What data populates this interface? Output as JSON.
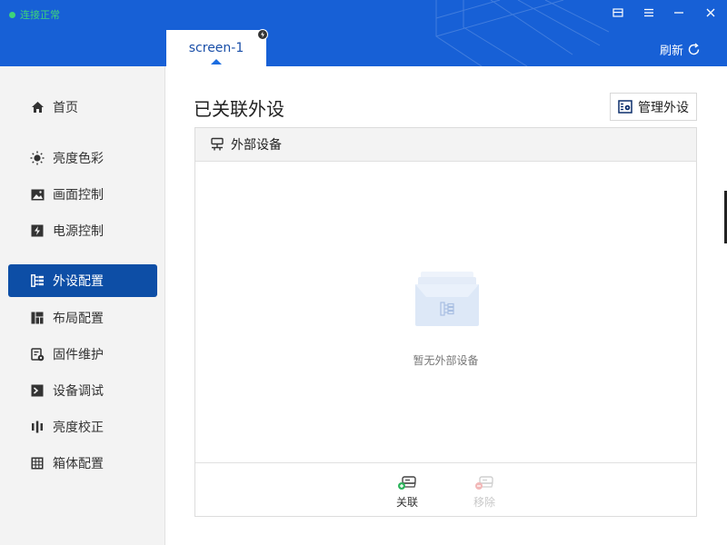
{
  "window": {
    "status_text": "连接正常",
    "status_color": "#3ed47a",
    "controls": [
      "menu-window-icon",
      "hamburger-icon",
      "minimize-icon",
      "close-icon"
    ]
  },
  "tabs": [
    {
      "label": "screen-1",
      "active": true
    }
  ],
  "header": {
    "refresh_label": "刷新"
  },
  "sidebar": {
    "items": [
      {
        "label": "首页",
        "icon": "home-icon",
        "active": false
      },
      {
        "label": "亮度色彩",
        "icon": "sun-icon",
        "active": false
      },
      {
        "label": "画面控制",
        "icon": "image-icon",
        "active": false
      },
      {
        "label": "电源控制",
        "icon": "power-icon",
        "active": false
      },
      {
        "label": "外设配置",
        "icon": "peripheral-icon",
        "active": true
      },
      {
        "label": "布局配置",
        "icon": "layout-icon",
        "active": false
      },
      {
        "label": "固件维护",
        "icon": "firmware-icon",
        "active": false
      },
      {
        "label": "设备调试",
        "icon": "terminal-icon",
        "active": false
      },
      {
        "label": "亮度校正",
        "icon": "calibrate-icon",
        "active": false
      },
      {
        "label": "箱体配置",
        "icon": "grid-icon",
        "active": false
      }
    ]
  },
  "main": {
    "title": "已关联外设",
    "manage_label": "管理外设",
    "panel": {
      "header": "外部设备",
      "empty_text": "暂无外部设备",
      "actions": [
        {
          "label": "关联",
          "enabled": true
        },
        {
          "label": "移除",
          "enabled": false
        }
      ]
    }
  },
  "colors": {
    "brand": "#1760d6",
    "active_nav": "#0d4ea6",
    "sidebar_bg": "#f3f3f3"
  }
}
